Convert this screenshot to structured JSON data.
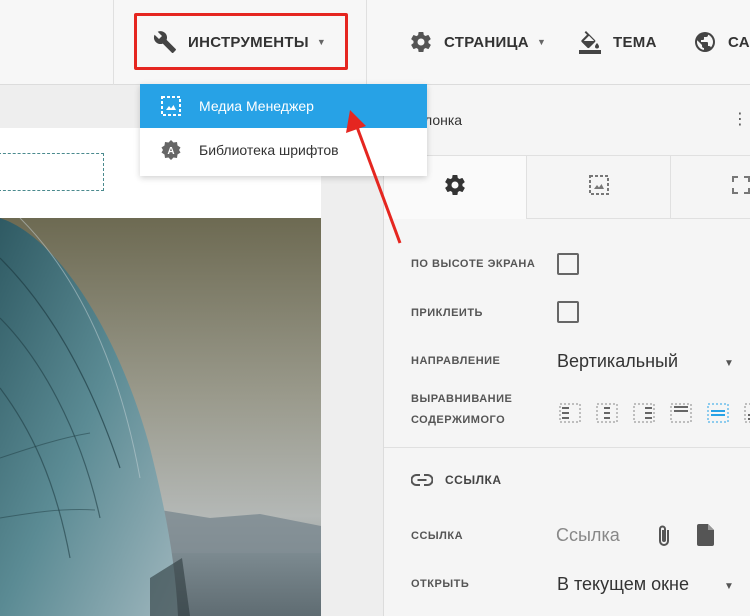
{
  "toolbar": {
    "tools": {
      "label": "ИНСТРУМЕНТЫ",
      "icon": "wrench-icon"
    },
    "page": {
      "label": "СТРАНИЦА",
      "icon": "gear-icon"
    },
    "theme": {
      "label": "ТЕМА",
      "icon": "paint-bucket-icon"
    },
    "site": {
      "label": "СА",
      "icon": "globe-icon"
    }
  },
  "dropdown": {
    "items": [
      {
        "label": "Медиа Менеджер",
        "icon": "image-frame-icon",
        "active": true
      },
      {
        "label": "Библиотека шрифтов",
        "icon": "font-badge-icon",
        "active": false
      }
    ]
  },
  "panel": {
    "header_title": "лонка",
    "more": "⋮",
    "props": {
      "full_height": {
        "label": "ПО ВЫСОТЕ ЭКРАНА",
        "checked": false
      },
      "sticky": {
        "label": "ПРИКЛЕИТЬ",
        "checked": false
      },
      "direction": {
        "label": "НАПРАВЛЕНИЕ",
        "value": "Вертикальный"
      },
      "align": {
        "label_line1": "ВЫРАВНИВАНИЕ",
        "label_line2": "СОДЕРЖИМОГО"
      }
    },
    "link_section": {
      "title": "ССЫЛКА",
      "link_label": "ССЫЛКА",
      "link_placeholder": "Ссылка",
      "open_label": "ОТКРЫТЬ",
      "open_value": "В текущем окне"
    }
  },
  "colors": {
    "accent": "#27a2e6",
    "highlight": "#e52620"
  }
}
